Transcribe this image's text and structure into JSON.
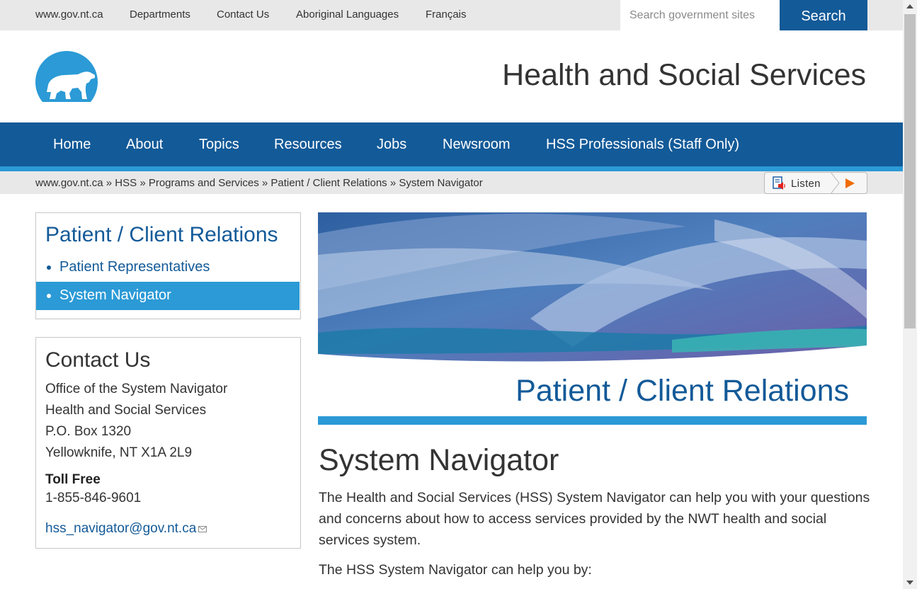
{
  "utility_nav": {
    "links": [
      "www.gov.nt.ca",
      "Departments",
      "Contact Us",
      "Aboriginal Languages",
      "Français"
    ],
    "search_placeholder": "Search government sites",
    "search_button": "Search"
  },
  "header": {
    "logo_icon": "polar-bear-logo-icon",
    "site_title": "Health and Social Services"
  },
  "main_nav": {
    "items": [
      "Home",
      "About",
      "Topics",
      "Resources",
      "Jobs",
      "Newsroom",
      "HSS Professionals (Staff Only)"
    ]
  },
  "breadcrumb": {
    "items": [
      "www.gov.nt.ca",
      "HSS",
      "Programs and Services",
      "Patient / Client Relations",
      "System Navigator"
    ],
    "separator": "»"
  },
  "listen": {
    "label": "Listen",
    "icon": "speaker-document-icon",
    "play_icon": "play-icon"
  },
  "sidebar_nav": {
    "title": "Patient / Client Relations",
    "items": [
      {
        "label": "Patient Representatives",
        "active": false
      },
      {
        "label": "System Navigator",
        "active": true
      }
    ]
  },
  "contact": {
    "title": "Contact Us",
    "address_lines": [
      "Office of the System Navigator",
      "Health and Social Services",
      "P.O. Box 1320",
      "Yellowknife, NT X1A 2L9"
    ],
    "toll_free_label": "Toll Free",
    "toll_free_number": "1-855-846-9601",
    "email": "hss_navigator@gov.nt.ca",
    "email_icon": "mail-icon"
  },
  "banner": {
    "title": "Patient / Client Relations"
  },
  "content": {
    "title": "System Navigator",
    "paragraphs": [
      "The Health and Social Services (HSS) System Navigator can help you with your questions and concerns about how to access services provided by the NWT health and social services system.",
      "The HSS System Navigator can help you by:"
    ]
  },
  "colors": {
    "primary_blue": "#135a98",
    "accent_blue": "#2b9ad6",
    "utility_gray": "#e8e8e8"
  }
}
